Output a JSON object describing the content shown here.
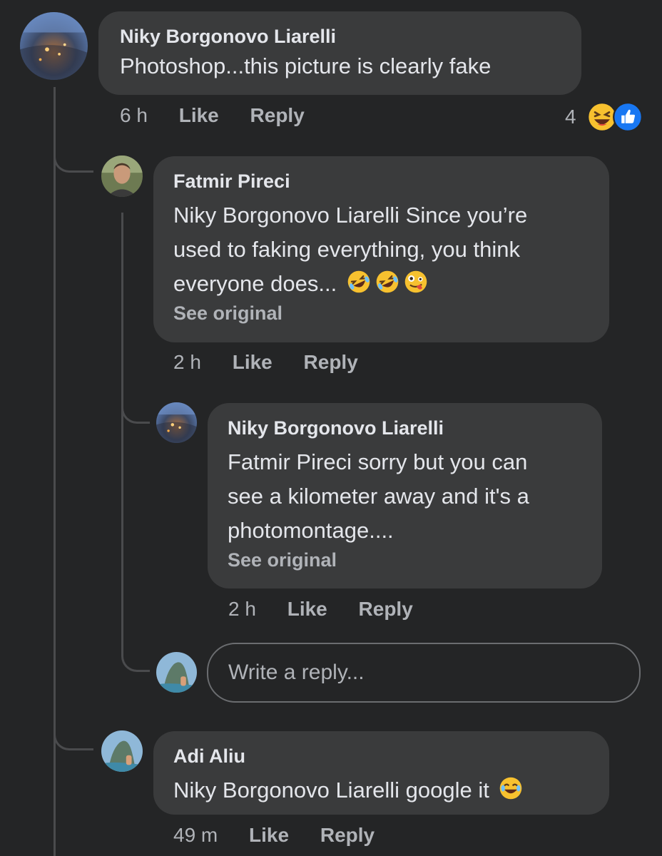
{
  "thread": {
    "comment1": {
      "author": "Niky Borgonovo Liarelli",
      "text": "Photoshop...this picture is clearly fake",
      "time": "6 h",
      "like_label": "Like",
      "reply_label": "Reply",
      "reaction_count": "4",
      "reactions": [
        "laughing-emoji",
        "like-reaction"
      ]
    },
    "reply1": {
      "author": "Fatmir Pireci",
      "text_lines": [
        "Niky Borgonovo Liarelli Since you’re",
        "used to faking everything, you think",
        "everyone does..."
      ],
      "emojis": [
        "rofl-emoji",
        "rofl-emoji",
        "zany-face-emoji"
      ],
      "see_original": "See original",
      "time": "2 h",
      "like_label": "Like",
      "reply_label": "Reply"
    },
    "reply2": {
      "author": "Niky Borgonovo Liarelli",
      "text_lines": [
        "Fatmir Pireci sorry but you can",
        "see a kilometer away and it's a",
        "photomontage...."
      ],
      "see_original": "See original",
      "time": "2 h",
      "like_label": "Like",
      "reply_label": "Reply"
    },
    "reply_box": {
      "placeholder": "Write a reply..."
    },
    "comment2": {
      "author": "Adi Aliu",
      "text": "Niky Borgonovo Liarelli google it",
      "emojis": [
        "tears-of-joy-emoji"
      ],
      "time": "49 m",
      "like_label": "Like",
      "reply_label": "Reply"
    }
  },
  "colors": {
    "background": "#242526",
    "bubble": "#3a3b3c",
    "text_primary": "#e4e6eb",
    "text_secondary": "#b0b3b8",
    "like_blue": "#1877f2"
  }
}
